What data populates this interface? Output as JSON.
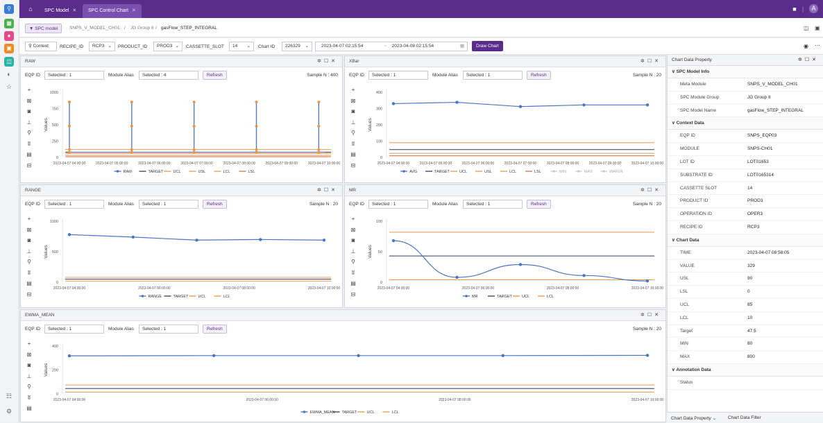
{
  "app": {
    "tabs": [
      {
        "label": "SPC Model"
      },
      {
        "label": "SPC Control Chart"
      }
    ],
    "user_initial": "A",
    "colors": {
      "brand": "#5a2d8c",
      "series": "#4a74c4",
      "target": "#2f3a58",
      "ucl": "#e8964a",
      "lsl": "#d67040"
    }
  },
  "breadcrumb": {
    "button": "SPC model",
    "items": [
      "SNPS_V_MODEL_CH01",
      "/",
      "JG Group II",
      "/",
      "gasFlow_STEP_INTEGRAL"
    ]
  },
  "context": {
    "btn": "Context",
    "recipe_label": "RECIPE_ID",
    "recipe_value": "RCP3",
    "product_label": "PRODUCT_ID",
    "product_value": "PROD3",
    "cassette_label": "CASSETTE_SLOT",
    "cassette_value": "14",
    "chart_id_label": "Chart ID",
    "chart_id_value": "226329",
    "date_from": "2023-04-07 02:15:54",
    "date_to": "2023-04-08 02:15:54",
    "date_sep": "~",
    "draw_label": "Draw Chart"
  },
  "common": {
    "eqp_label": "EQP ID",
    "alias_label": "Module Alias",
    "refresh": "Refresh",
    "values_axis": "Values"
  },
  "panels": {
    "raw": {
      "title": "RAW",
      "eqp": "Selected : 1",
      "alias": "Selected : 4",
      "sample": "Sample N : 400"
    },
    "xbar": {
      "title": "XBar",
      "eqp": "Selected : 1",
      "alias": "Selected : 1",
      "sample": "Sample N : 20"
    },
    "range": {
      "title": "RANGE",
      "eqp": "Selected : 1",
      "alias": "Selected : 1",
      "sample": "Sample N : 20"
    },
    "mr": {
      "title": "MR",
      "eqp": "Selected : 1",
      "alias": "Selected : 1",
      "sample": "Sample N : 20"
    },
    "ewma": {
      "title": "EWMA_MEAN",
      "eqp": "Selected : 1",
      "alias": "Selected : 1",
      "sample": "Sample N : 20"
    }
  },
  "chart_data": [
    {
      "id": "raw",
      "type": "line",
      "ylim": [
        0,
        1000
      ],
      "yticks": [
        0,
        250,
        500,
        750,
        1000
      ],
      "xticks": [
        "2023-04-07 04:00:00",
        "2023-04-07 05:00:00",
        "2023-04-07 06:00:00",
        "2023-04-07 07:00:00",
        "2023-04-07 08:00:00",
        "2023-04-07 09:00:00",
        "2023-04-07 10:00:00"
      ],
      "spikes": [
        0,
        2.35,
        4.7,
        7.05,
        9.4
      ],
      "spike_values": [
        80,
        850,
        480,
        120
      ],
      "lines": [
        {
          "name": "TARGET",
          "value": 80
        },
        {
          "name": "UCL",
          "value": 120
        },
        {
          "name": "USL",
          "value": 60
        },
        {
          "name": "LCL",
          "value": 30
        },
        {
          "name": "LSL",
          "value": 10
        }
      ],
      "legend": [
        "RAW",
        "TARGET",
        "UCL",
        "USL",
        "LCL",
        "LSL"
      ]
    },
    {
      "id": "xbar",
      "type": "line",
      "ylim": [
        0,
        400
      ],
      "yticks": [
        0,
        100,
        200,
        300,
        400
      ],
      "xticks": [
        "2023-04-07 04:00:00",
        "2023-04-07 05:00:00",
        "2023-04-07 06:00:00",
        "2023-04-07 07:00:00",
        "2023-04-07 08:00:00",
        "2023-04-07 09:00:00",
        "2023-04-07 10:00:00"
      ],
      "x": [
        0,
        2.4,
        4.8,
        7.2,
        9.6
      ],
      "values": [
        330,
        338,
        312,
        322,
        322
      ],
      "lines": [
        {
          "name": "UCL",
          "value": 90
        },
        {
          "name": "TARGET",
          "value": 48
        },
        {
          "name": "LSL",
          "value": 10
        },
        {
          "name": "LCL",
          "value": 25
        }
      ],
      "legend": [
        "AVG",
        "TARGET",
        "UCL",
        "USL",
        "LCL",
        "LSL",
        "MIN",
        "MAX",
        "WAFER"
      ]
    },
    {
      "id": "range",
      "type": "line",
      "ylim": [
        0,
        1000
      ],
      "yticks": [
        0,
        500,
        1000
      ],
      "xticks": [
        "2023-04-07 04:00:00",
        "2023-04-07 06:00:00",
        "2023-04-07 08:00:00",
        "2023-04-07 10:00:00"
      ],
      "x": [
        0,
        2.4,
        4.8,
        7.2,
        9.6
      ],
      "values": [
        780,
        740,
        690,
        700,
        690
      ],
      "lines": [
        {
          "name": "UCL",
          "value": 80
        },
        {
          "name": "TARGET",
          "value": 50
        },
        {
          "name": "LCL",
          "value": 20
        }
      ],
      "legend": [
        "RANGE",
        "TARGET",
        "UCL",
        "LCL"
      ]
    },
    {
      "id": "mr",
      "type": "line",
      "ylim": [
        0,
        100
      ],
      "yticks": [
        0,
        50,
        100
      ],
      "xticks": [
        "2023-04-07 04:00:00",
        "2023-04-07 06:00:00",
        "2023-04-07 08:00:00",
        "2023-04-07 10:00:00"
      ],
      "x": [
        0,
        2.4,
        4.8,
        7.2,
        9.6
      ],
      "values": [
        68,
        8,
        29,
        11,
        2
      ],
      "lines": [
        {
          "name": "UCL",
          "value": 82
        },
        {
          "name": "TARGET",
          "value": 43
        },
        {
          "name": "LCL",
          "value": 4
        }
      ],
      "legend": [
        "MR",
        "TARGET",
        "UCL",
        "LCL"
      ]
    },
    {
      "id": "ewma",
      "type": "line",
      "ylim": [
        0,
        400
      ],
      "yticks": [
        0,
        200,
        400
      ],
      "xticks": [
        "2023-04-07 04:00:00",
        "2023-04-07 06:00:00",
        "2023-04-07 08:00:00",
        "2023-04-07 10:00:00"
      ],
      "x": [
        0,
        2.4,
        4.8,
        7.2,
        9.6
      ],
      "values": [
        318,
        320,
        320,
        320,
        322
      ],
      "lines": [
        {
          "name": "UCL",
          "value": 75
        },
        {
          "name": "TARGET",
          "value": 45
        },
        {
          "name": "LCL",
          "value": 15
        }
      ],
      "legend": [
        "EWMA_MEAN",
        "TARGET",
        "UCL",
        "LCL"
      ]
    }
  ],
  "right_panel": {
    "title": "Chart Data Property",
    "sections": [
      {
        "title": "SPC Model Info",
        "rows": [
          {
            "k": "Meta Module",
            "v": "SNPS_V_MODEL_CH01"
          },
          {
            "k": "SPC Module Group",
            "v": "JG Group II"
          },
          {
            "k": "SPC Model Name",
            "v": "gasFlow_STEP_INTEGRAL"
          }
        ]
      },
      {
        "title": "Context Data",
        "rows": [
          {
            "k": "EQP ID",
            "v": "SNPS_EQP03"
          },
          {
            "k": "MODULE",
            "v": "SNPS-CH01"
          },
          {
            "k": "LOT ID",
            "v": "LOT01653"
          },
          {
            "k": "SUBSTRATE ID",
            "v": "LOT0165314"
          },
          {
            "k": "CASSETTE SLOT",
            "v": "14"
          },
          {
            "k": "PRODUCT ID",
            "v": "PROD3"
          },
          {
            "k": "OPERATION ID",
            "v": "OPER3"
          },
          {
            "k": "RECIPE ID",
            "v": "RCP3"
          }
        ]
      },
      {
        "title": "Chart Data",
        "rows": [
          {
            "k": "TIME",
            "v": "2023-04-07 08:58:05"
          },
          {
            "k": "VALUE",
            "v": "329"
          },
          {
            "k": "USL",
            "v": "90"
          },
          {
            "k": "LSL",
            "v": "0"
          },
          {
            "k": "UCL",
            "v": "85"
          },
          {
            "k": "LCL",
            "v": "10"
          },
          {
            "k": "Target",
            "v": "47.5"
          },
          {
            "k": "MIN",
            "v": "80"
          },
          {
            "k": "MAX",
            "v": "800"
          }
        ]
      },
      {
        "title": "Annotation Data",
        "rows": [
          {
            "k": "Status",
            "v": ""
          }
        ]
      }
    ],
    "footer_tabs": [
      "Chart Data Property",
      "Chart Data Filter"
    ]
  }
}
